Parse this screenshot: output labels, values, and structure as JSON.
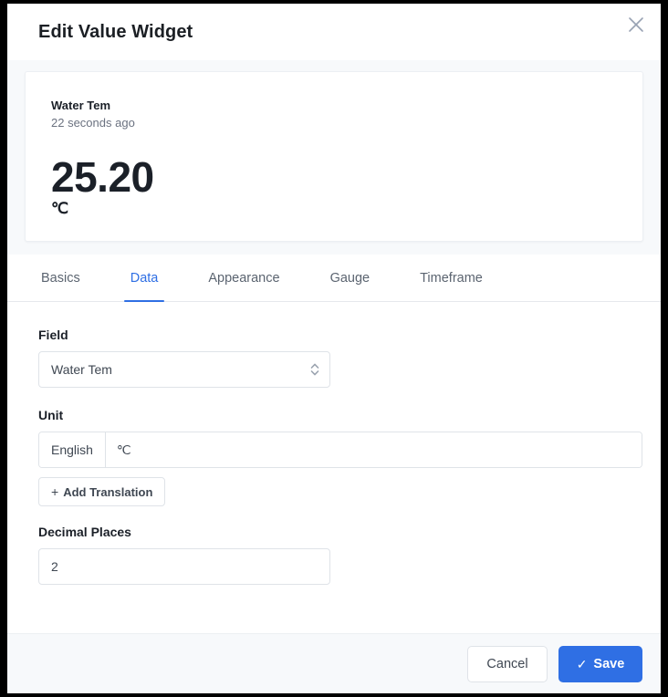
{
  "dialog": {
    "title": "Edit Value Widget",
    "close_icon": "close-icon"
  },
  "preview": {
    "widget_title": "Water Tem",
    "timestamp": "22 seconds ago",
    "value": "25.20",
    "unit": "℃"
  },
  "tabs": [
    {
      "label": "Basics",
      "active": false
    },
    {
      "label": "Data",
      "active": true
    },
    {
      "label": "Appearance",
      "active": false
    },
    {
      "label": "Gauge",
      "active": false
    },
    {
      "label": "Timeframe",
      "active": false
    }
  ],
  "form": {
    "field": {
      "label": "Field",
      "selected": "Water Tem",
      "stepper_icon": "chevron-up-down-icon"
    },
    "unit": {
      "label": "Unit",
      "language": "English",
      "value": "℃",
      "placeholder": "",
      "add_translation_label": "Add Translation",
      "add_translation_icon": "plus-icon"
    },
    "decimal_places": {
      "label": "Decimal Places",
      "value": "2",
      "placeholder": ""
    }
  },
  "footer": {
    "cancel_label": "Cancel",
    "save_label": "Save",
    "save_icon": "check-icon"
  },
  "colors": {
    "accent": "#2f6fe4",
    "text_primary": "#1b2028",
    "text_muted": "#6b7280",
    "surface": "#ffffff",
    "surface_alt": "#f7f9fb",
    "border": "#dfe3e8"
  }
}
